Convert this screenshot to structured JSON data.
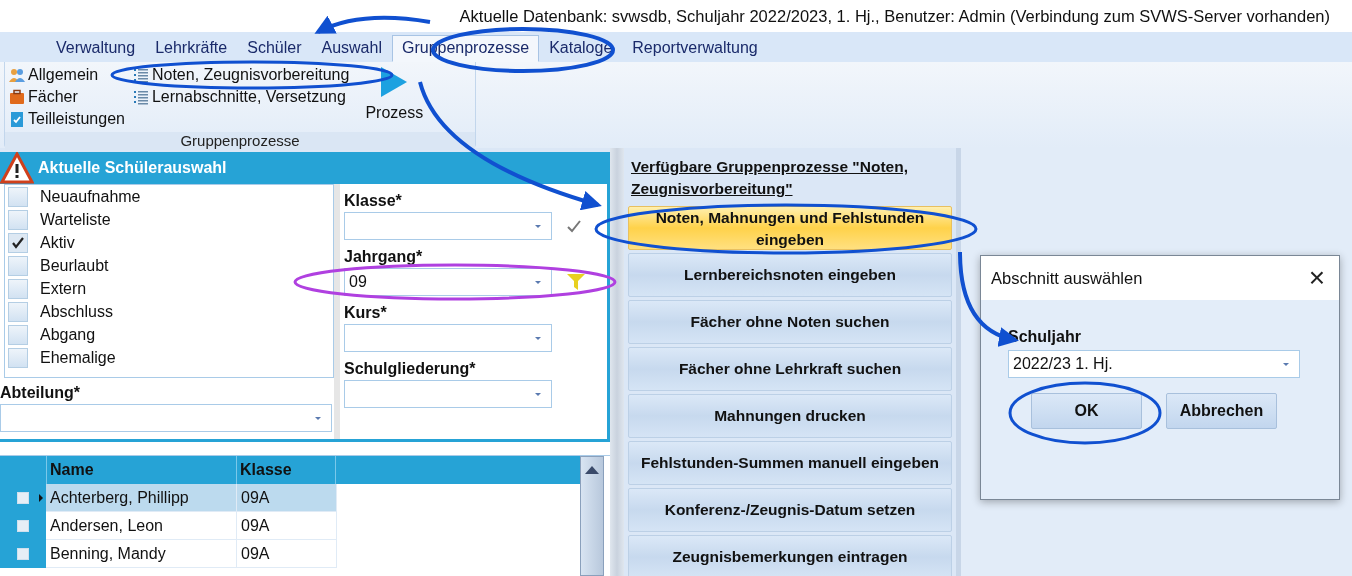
{
  "info_bar": {
    "text": "Aktuelle Datenbank: svwsdb, Schuljahr 2022/2023, 1. Hj., Benutzer: Admin (Verbindung zum SVWS-Server vorhanden)"
  },
  "menu_tabs": [
    {
      "label": "Verwaltung",
      "selected": false
    },
    {
      "label": "Lehrkräfte",
      "selected": false
    },
    {
      "label": "Schüler",
      "selected": false
    },
    {
      "label": "Auswahl",
      "selected": false
    },
    {
      "label": "Gruppenprozesse",
      "selected": true
    },
    {
      "label": "Kataloge",
      "selected": false
    },
    {
      "label": "Reportverwaltung",
      "selected": false
    }
  ],
  "ribbon": {
    "columns": [
      [
        {
          "label": "Allgemein"
        },
        {
          "label": "Fächer"
        },
        {
          "label": "Teilleistungen"
        }
      ],
      [
        {
          "label": "Noten, Zeugnisvorbereitung"
        },
        {
          "label": "Lernabschnitte, Versetzung"
        }
      ]
    ],
    "process_button": "Prozess",
    "group_label": "Gruppenprozesse"
  },
  "selection_panel": {
    "title": "Aktuelle Schülerauswahl",
    "statuses": [
      {
        "label": "Neuaufnahme",
        "checked": false
      },
      {
        "label": "Warteliste",
        "checked": false
      },
      {
        "label": "Aktiv",
        "checked": true
      },
      {
        "label": "Beurlaubt",
        "checked": false
      },
      {
        "label": "Extern",
        "checked": false
      },
      {
        "label": "Abschluss",
        "checked": false
      },
      {
        "label": "Abgang",
        "checked": false
      },
      {
        "label": "Ehemalige",
        "checked": false
      }
    ],
    "department": {
      "label": "Abteilung*"
    },
    "fields": [
      {
        "label": "Klasse*"
      },
      {
        "label": "Jahrgang*",
        "value": "09"
      },
      {
        "label": "Kurs*"
      },
      {
        "label": "Schulgliederung*"
      }
    ]
  },
  "students": {
    "columns": [
      "Name",
      "Klasse"
    ],
    "rows": [
      {
        "name": "Achterberg, Phillipp",
        "klasse": "09A",
        "selected": true
      },
      {
        "name": "Andersen, Leon",
        "klasse": "09A",
        "selected": false
      },
      {
        "name": "Benning, Mandy",
        "klasse": "09A",
        "selected": false
      }
    ]
  },
  "processes": {
    "heading": "Verfügbare Gruppenprozesse \"Noten, Zeugnisvorbereitung\"",
    "buttons": [
      {
        "label": "Noten, Mahnungen und Fehlstunden eingeben",
        "selected": true
      },
      {
        "label": "Lernbereichsnoten eingeben",
        "selected": false
      },
      {
        "label": "Fächer ohne Noten suchen",
        "selected": false
      },
      {
        "label": "Fächer ohne Lehrkraft suchen",
        "selected": false
      },
      {
        "label": "Mahnungen drucken",
        "selected": false
      },
      {
        "label": "Fehlstunden-Summen manuell eingeben",
        "selected": false
      },
      {
        "label": "Konferenz-/Zeugnis-Datum setzen",
        "selected": false
      },
      {
        "label": "Zeugnisbemerkungen eintragen",
        "selected": false
      }
    ]
  },
  "dialog": {
    "title": "Abschnitt auswählen",
    "close": "×",
    "field_label": "Schuljahr",
    "field_value": "2022/23 1. Hj.",
    "buttons": [
      "OK",
      "Abbrechen"
    ]
  }
}
